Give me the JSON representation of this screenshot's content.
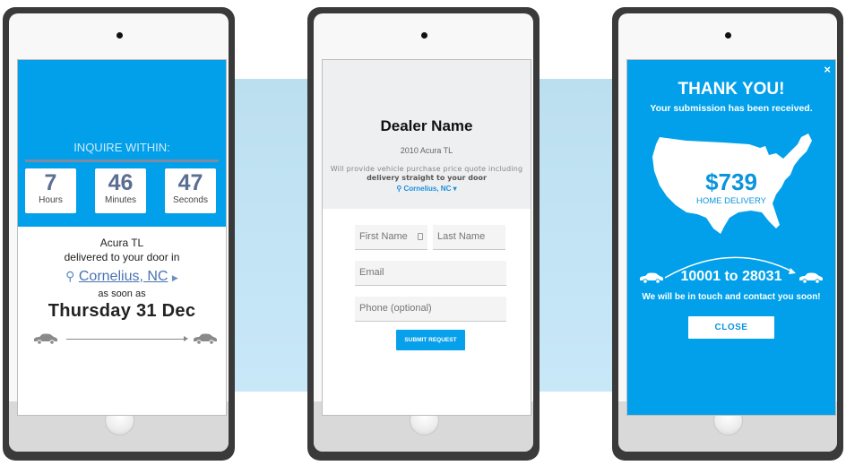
{
  "colors": {
    "brand_blue": "#02a0ea",
    "timer_digit": "#5b6f94",
    "link_blue": "#4a73b3",
    "background_band": "#c8e8f8"
  },
  "phone1": {
    "header": "INQUIRE WITHIN:",
    "countdown": [
      {
        "value": "7",
        "unit": "Hours"
      },
      {
        "value": "46",
        "unit": "Minutes"
      },
      {
        "value": "47",
        "unit": "Seconds"
      }
    ],
    "vehicle": "Acura TL",
    "delivered_text": "delivered to your door in",
    "location": "Cornelius, NC",
    "location_icon": "map-pin-icon",
    "as_soon_as": "as soon as",
    "date": "Thursday 31 Dec"
  },
  "phone2": {
    "dealer_name": "Dealer Name",
    "vehicle": "2010 Acura TL",
    "description_line1": "Will provide vehicle purchase price quote including",
    "description_line2": "delivery straight to your door",
    "location": "Cornelius, NC",
    "form": {
      "first_name_placeholder": "First Name",
      "last_name_placeholder": "Last Name",
      "email_placeholder": "Email",
      "phone_placeholder": "Phone (optional)",
      "submit_label": "SUBMIT REQUEST"
    }
  },
  "phone3": {
    "close_x": "×",
    "title": "THANK YOU!",
    "subtitle": "Your submission has been received.",
    "price": "$739",
    "price_label": "HOME DELIVERY",
    "route": "10001 to 28031",
    "message": "We will be in touch and contact you soon!",
    "close_label": "CLOSE"
  }
}
